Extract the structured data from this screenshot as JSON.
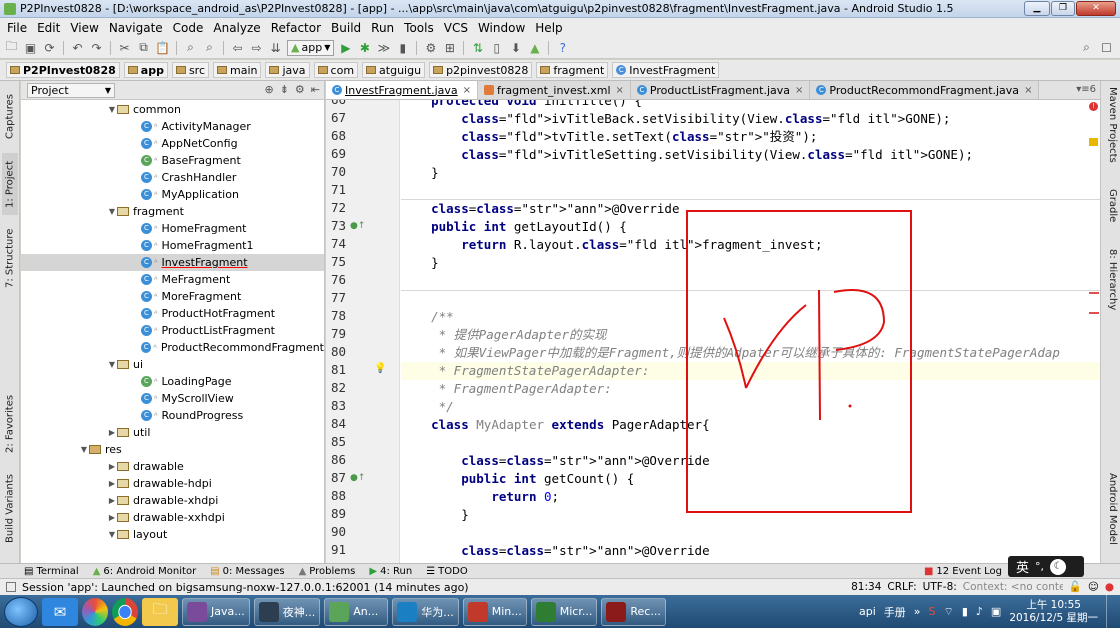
{
  "window": {
    "title": "P2PInvest0828 - [D:\\workspace_android_as\\P2PInvest0828] - [app] - ...\\app\\src\\main\\java\\com\\atguigu\\p2pinvest0828\\fragment\\InvestFragment.java - Android Studio 1.5"
  },
  "menu": [
    "File",
    "Edit",
    "View",
    "Navigate",
    "Code",
    "Analyze",
    "Refactor",
    "Build",
    "Run",
    "Tools",
    "VCS",
    "Window",
    "Help"
  ],
  "toolbar": {
    "run_config": "app"
  },
  "breadcrumb": [
    "P2PInvest0828",
    "app",
    "src",
    "main",
    "java",
    "com",
    "atguigu",
    "p2pinvest0828",
    "fragment",
    "InvestFragment"
  ],
  "sidebar_left": {
    "captures": "Captures",
    "project": "1: Project",
    "structure": "7: Structure",
    "favorites": "2: Favorites",
    "build_variants": "Build Variants"
  },
  "sidebar_right": {
    "maven": "Maven Projects",
    "gradle": "Gradle",
    "hierarchy": "8: Hierarchy",
    "android_model": "Android Model"
  },
  "project_panel": {
    "view_label": "Project",
    "tree": [
      {
        "label": "common",
        "kind": "folder",
        "level": 0,
        "open": true
      },
      {
        "label": "ActivityManager",
        "kind": "class",
        "level": 1
      },
      {
        "label": "AppNetConfig",
        "kind": "class",
        "level": 1
      },
      {
        "label": "BaseFragment",
        "kind": "class",
        "level": 1
      },
      {
        "label": "CrashHandler",
        "kind": "class",
        "level": 1
      },
      {
        "label": "MyApplication",
        "kind": "class",
        "level": 1
      },
      {
        "label": "fragment",
        "kind": "folder",
        "level": 0,
        "open": true
      },
      {
        "label": "HomeFragment",
        "kind": "class",
        "level": 1
      },
      {
        "label": "HomeFragment1",
        "kind": "class",
        "level": 1
      },
      {
        "label": "InvestFragment",
        "kind": "class",
        "level": 1,
        "selected": true
      },
      {
        "label": "MeFragment",
        "kind": "class",
        "level": 1
      },
      {
        "label": "MoreFragment",
        "kind": "class",
        "level": 1
      },
      {
        "label": "ProductHotFragment",
        "kind": "class",
        "level": 1
      },
      {
        "label": "ProductListFragment",
        "kind": "class",
        "level": 1
      },
      {
        "label": "ProductRecommondFragment",
        "kind": "class",
        "level": 1
      },
      {
        "label": "ui",
        "kind": "folder",
        "level": 0,
        "open": true
      },
      {
        "label": "LoadingPage",
        "kind": "class",
        "level": 1
      },
      {
        "label": "MyScrollView",
        "kind": "class",
        "level": 1
      },
      {
        "label": "RoundProgress",
        "kind": "class",
        "level": 1
      },
      {
        "label": "util",
        "kind": "folder",
        "level": 0,
        "open": false
      },
      {
        "label": "res",
        "kind": "folder",
        "level": -1,
        "open": true
      },
      {
        "label": "drawable",
        "kind": "folder",
        "level": 0,
        "open": false
      },
      {
        "label": "drawable-hdpi",
        "kind": "folder",
        "level": 0,
        "open": false
      },
      {
        "label": "drawable-xhdpi",
        "kind": "folder",
        "level": 0,
        "open": false
      },
      {
        "label": "drawable-xxhdpi",
        "kind": "folder",
        "level": 0,
        "open": false
      },
      {
        "label": "layout",
        "kind": "folder",
        "level": 0,
        "open": true
      }
    ]
  },
  "editor": {
    "tabs": [
      {
        "label": "InvestFragment.java",
        "active": true,
        "kind": "class"
      },
      {
        "label": "fragment_invest.xml",
        "active": false,
        "kind": "xml"
      },
      {
        "label": "ProductListFragment.java",
        "active": false,
        "kind": "class"
      },
      {
        "label": "ProductRecommondFragment.java",
        "active": false,
        "kind": "class"
      }
    ],
    "tabs_overflow": "▾≡6",
    "lines": [
      {
        "n": "66",
        "text": "    protected void initTitle() {"
      },
      {
        "n": "67",
        "text": "        ivTitleBack.setVisibility(View.GONE);"
      },
      {
        "n": "68",
        "text": "        tvTitle.setText(\"投资\");"
      },
      {
        "n": "69",
        "text": "        ivTitleSetting.setVisibility(View.GONE);"
      },
      {
        "n": "70",
        "text": "    }"
      },
      {
        "n": "71",
        "text": ""
      },
      {
        "n": "72",
        "text": "    @Override"
      },
      {
        "n": "73",
        "text": "    public int getLayoutId() {"
      },
      {
        "n": "74",
        "text": "        return R.layout.fragment_invest;"
      },
      {
        "n": "75",
        "text": "    }"
      },
      {
        "n": "76",
        "text": ""
      },
      {
        "n": "77",
        "text": ""
      },
      {
        "n": "78",
        "text": "    /**"
      },
      {
        "n": "79",
        "text": "     * 提供PagerAdapter的实现"
      },
      {
        "n": "80",
        "text": "     * 如果ViewPager中加载的是Fragment,则提供的Adpater可以继承于具体的: FragmentStatePagerAdap"
      },
      {
        "n": "81",
        "text": "     * FragmentStatePagerAdapter:"
      },
      {
        "n": "82",
        "text": "     * FragmentPagerAdapter:"
      },
      {
        "n": "83",
        "text": "     */"
      },
      {
        "n": "84",
        "text": "    class MyAdapter extends PagerAdapter{"
      },
      {
        "n": "85",
        "text": ""
      },
      {
        "n": "86",
        "text": "        @Override"
      },
      {
        "n": "87",
        "text": "        public int getCount() {"
      },
      {
        "n": "88",
        "text": "            return 0;"
      },
      {
        "n": "89",
        "text": "        }"
      },
      {
        "n": "90",
        "text": ""
      },
      {
        "n": "91",
        "text": "        @Override"
      }
    ],
    "annotation_text": "VP"
  },
  "bottom_tabs": [
    "Terminal",
    "6: Android Monitor",
    "0: Messages",
    "Problems",
    "4: Run",
    "TODO"
  ],
  "bottom_right": {
    "event_log": "12 Event Log"
  },
  "ime": {
    "label": "英"
  },
  "status": {
    "message": "Session 'app': Launched on bigsamsung-noxw-127.0.0.1:62001 (14 minutes ago)",
    "position": "81:34",
    "line_sep": "CRLF:",
    "encoding": "UTF-8:",
    "context": "Context: <no context>"
  },
  "taskbar": {
    "tasks": [
      "Java...",
      "夜神...",
      "An...",
      "华为...",
      "Min...",
      "Micr...",
      "Rec..."
    ],
    "extra": [
      "api",
      "手册"
    ],
    "clock_time": "上午 10:55",
    "clock_date": "2016/12/5 星期一"
  },
  "colors": {
    "accent_red": "#e01010",
    "keyword": "#000080",
    "string": "#008000",
    "field": "#660e7a",
    "comment": "#808080"
  }
}
